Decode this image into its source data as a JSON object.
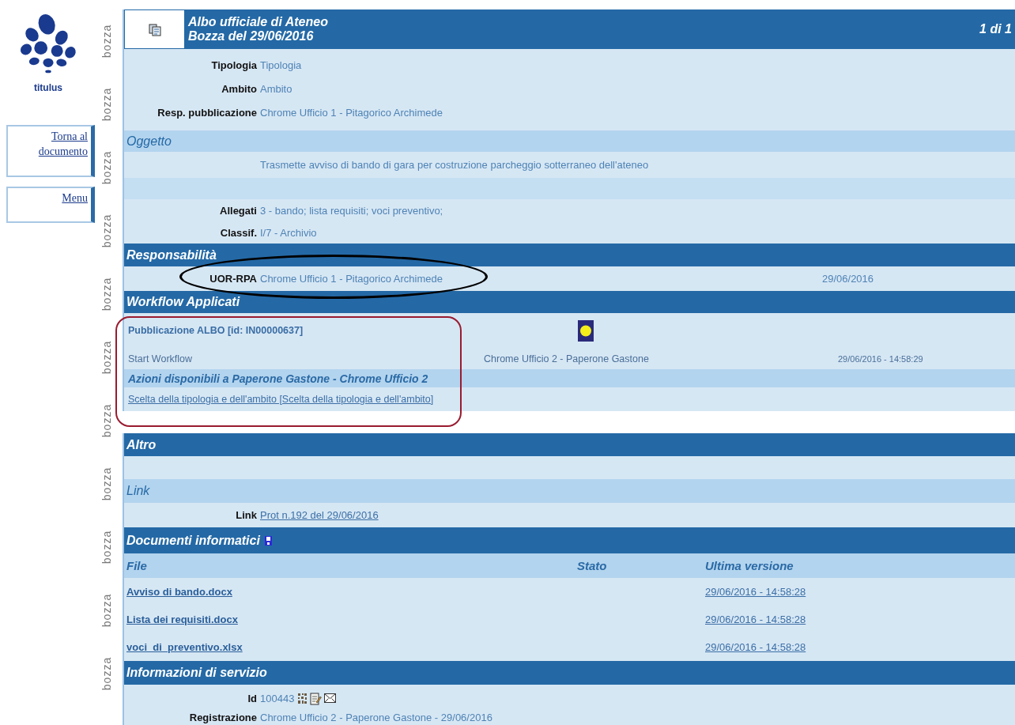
{
  "sidebar": {
    "logo_text": "titulus",
    "links": [
      {
        "label": "Torna al documento"
      },
      {
        "label": "Menu"
      }
    ]
  },
  "draft_marks": [
    "bozza",
    "bozza",
    "bozza",
    "bozza",
    "bozza",
    "bozza",
    "bozza",
    "bozza",
    "bozza",
    "bozza",
    "bozza"
  ],
  "header": {
    "title": "Albo ufficiale di Ateneo",
    "subtitle": "Bozza del 29/06/2016",
    "page": "1 di 1"
  },
  "details": [
    {
      "label": "Tipologia",
      "value": "Tipologia"
    },
    {
      "label": "Ambito",
      "value": "Ambito"
    },
    {
      "label": "Resp. pubblicazione",
      "value": "Chrome Ufficio 1  -  Pitagorico Archimede"
    }
  ],
  "oggetto": {
    "heading": "Oggetto",
    "text": "Trasmette avviso di bando di gara per costruzione parcheggio sotterraneo dell'ateneo"
  },
  "attachments": [
    {
      "label": "Allegati",
      "value": "3 -  bando; lista requisiti; voci preventivo;"
    },
    {
      "label": "Classif.",
      "value": "I/7 - Archivio"
    }
  ],
  "responsabilita": {
    "heading": "Responsabilità",
    "label": "UOR-RPA",
    "value": "Chrome Ufficio 1 - Pitagorico Archimede",
    "date": "29/06/2016"
  },
  "workflow": {
    "heading": "Workflow Applicati",
    "name": "Pubblicazione ALBO [id: IN00000637]",
    "step": "Start Workflow",
    "assignee": "Chrome Ufficio 2 - Paperone Gastone",
    "timestamp": "29/06/2016  -  14:58:29",
    "actions_heading": "Azioni disponibili a Paperone Gastone - Chrome Ufficio 2",
    "action": "Scelta della tipologia e dell'ambito [Scelta della tipologia e dell'ambito]"
  },
  "altro": {
    "heading": "Altro"
  },
  "link": {
    "heading": "Link",
    "label": "Link",
    "value": "Prot n.192 del 29/06/2016"
  },
  "documents": {
    "heading": "Documenti informatici",
    "columns": [
      "File",
      "Stato",
      "Ultima versione"
    ],
    "rows": [
      {
        "file": "Avviso di bando.docx",
        "version": "29/06/2016 - 14:58:28"
      },
      {
        "file": "Lista dei requisiti.docx",
        "version": "29/06/2016 - 14:58:28"
      },
      {
        "file": "voci_di_preventivo.xlsx",
        "version": "29/06/2016 - 14:58:28"
      }
    ]
  },
  "service": {
    "heading": "Informazioni di servizio",
    "id_label": "Id",
    "id_value": "100443",
    "registration_label": "Registrazione",
    "registration_value": "Chrome Ufficio 2 - Paperone Gastone - 29/06/2016"
  }
}
